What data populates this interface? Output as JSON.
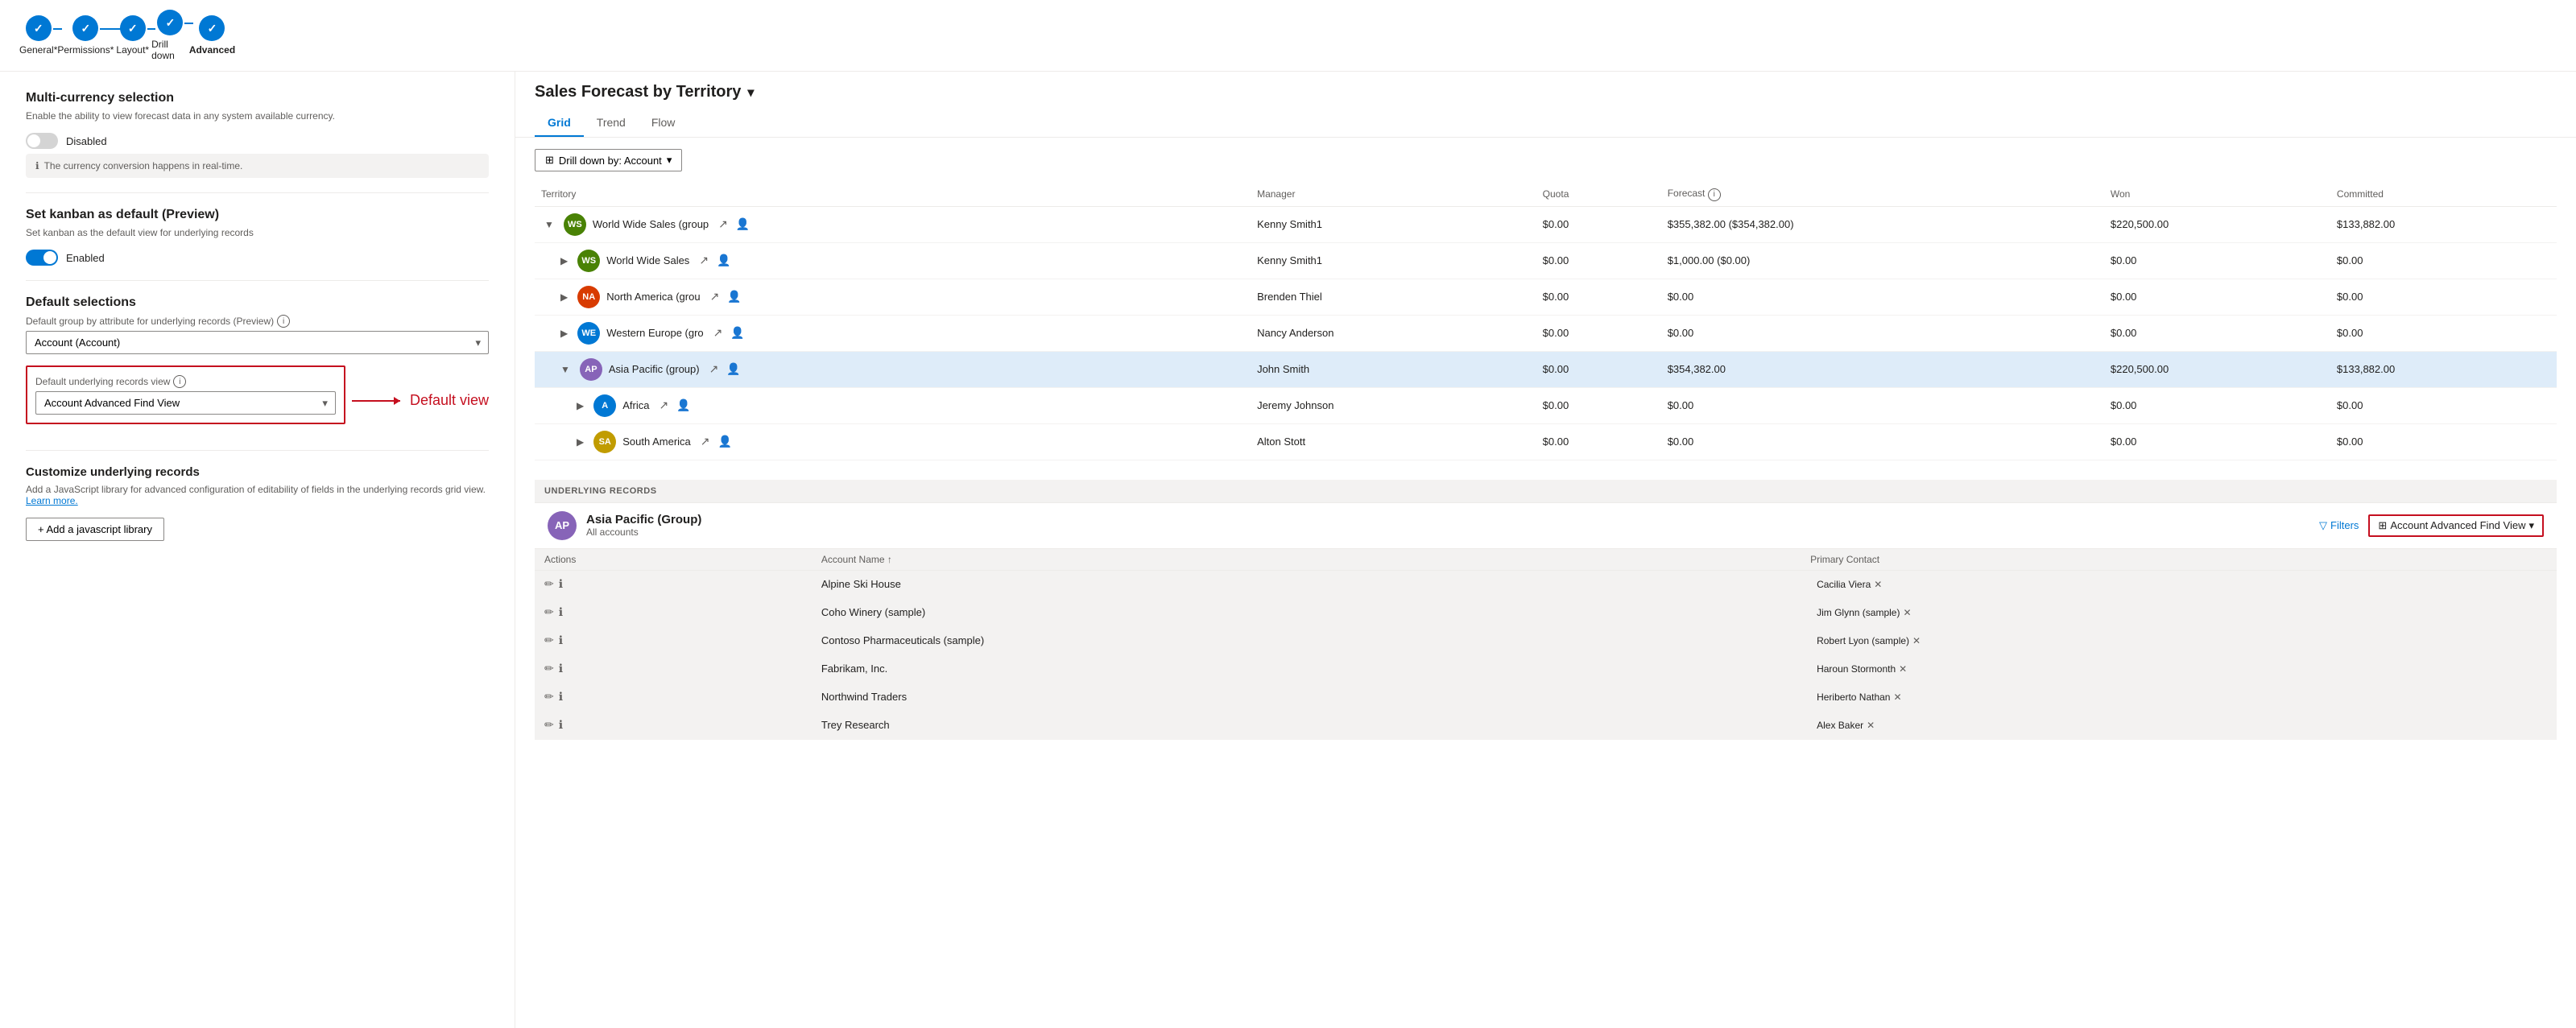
{
  "wizard": {
    "steps": [
      {
        "id": "general",
        "label": "General*",
        "active": false
      },
      {
        "id": "permissions",
        "label": "Permissions*",
        "active": false
      },
      {
        "id": "layout",
        "label": "Layout*",
        "active": false
      },
      {
        "id": "drilldown",
        "label": "Drill down",
        "active": false
      },
      {
        "id": "advanced",
        "label": "Advanced",
        "active": true
      }
    ]
  },
  "left": {
    "multicurrency": {
      "title": "Multi-currency selection",
      "desc": "Enable the ability to view forecast data in any system available currency.",
      "toggle_state": "Disabled",
      "info": "The currency conversion happens in real-time."
    },
    "kanban": {
      "title": "Set kanban as default (Preview)",
      "desc": "Set kanban as the default view for underlying records",
      "toggle_state": "Enabled"
    },
    "default_selections": {
      "title": "Default selections",
      "group_label": "Default group by attribute for underlying records (Preview)",
      "group_value": "Account (Account)",
      "view_label": "Default underlying records view",
      "view_value": "Account Advanced Find View",
      "annotation": "Default view"
    },
    "customize": {
      "title": "Customize underlying records",
      "desc": "Add a JavaScript library for advanced configuration of editability of fields in the underlying records grid view.",
      "learn_more": "Learn more.",
      "add_btn": "+ Add a javascript library"
    }
  },
  "right": {
    "title": "Sales Forecast by Territory",
    "tabs": [
      "Grid",
      "Trend",
      "Flow"
    ],
    "active_tab": "Grid",
    "drill_btn": "Drill down by: Account",
    "columns": [
      "Territory",
      "Manager",
      "Quota",
      "Forecast",
      "Won",
      "Committed"
    ],
    "rows": [
      {
        "indent": 0,
        "expanded": true,
        "avatar_text": "WS",
        "avatar_color": "#498205",
        "name": "World Wide Sales (group",
        "manager": "Kenny Smith1",
        "quota": "$0.00",
        "forecast": "$355,382.00 ($354,382.00)",
        "won": "$220,500.00",
        "committed": "$133,882.00",
        "highlight": false
      },
      {
        "indent": 1,
        "expanded": false,
        "avatar_text": "WS",
        "avatar_color": "#498205",
        "name": "World Wide Sales",
        "manager": "Kenny Smith1",
        "quota": "$0.00",
        "forecast": "$1,000.00 ($0.00)",
        "won": "$0.00",
        "committed": "$0.00",
        "highlight": false
      },
      {
        "indent": 1,
        "expanded": false,
        "avatar_text": "NA",
        "avatar_color": "#d83b01",
        "name": "North America (grou",
        "manager": "Brenden Thiel",
        "quota": "$0.00",
        "forecast": "$0.00",
        "won": "$0.00",
        "committed": "$0.00",
        "highlight": false
      },
      {
        "indent": 1,
        "expanded": false,
        "avatar_text": "WE",
        "avatar_color": "#0078d4",
        "name": "Western Europe (gro",
        "manager": "Nancy Anderson",
        "quota": "$0.00",
        "forecast": "$0.00",
        "won": "$0.00",
        "committed": "$0.00",
        "highlight": false
      },
      {
        "indent": 1,
        "expanded": true,
        "avatar_text": "AP",
        "avatar_color": "#8764b8",
        "name": "Asia Pacific (group)",
        "manager": "John Smith",
        "quota": "$0.00",
        "forecast": "$354,382.00",
        "won": "$220,500.00",
        "committed": "$133,882.00",
        "highlight": true
      },
      {
        "indent": 2,
        "expanded": false,
        "avatar_text": "A",
        "avatar_color": "#0078d4",
        "name": "Africa",
        "manager": "Jeremy Johnson",
        "quota": "$0.00",
        "forecast": "$0.00",
        "won": "$0.00",
        "committed": "$0.00",
        "highlight": false
      },
      {
        "indent": 2,
        "expanded": false,
        "avatar_text": "SA",
        "avatar_color": "#c19c00",
        "name": "South America",
        "manager": "Alton Stott",
        "quota": "$0.00",
        "forecast": "$0.00",
        "won": "$0.00",
        "committed": "$0.00",
        "highlight": false
      }
    ],
    "underlying": {
      "label": "UNDERLYING RECORDS",
      "group_avatar": "AP",
      "group_title": "Asia Pacific (Group)",
      "group_sub": "All accounts",
      "filter_btn": "Filters",
      "view_label": "Account Advanced Find View",
      "columns": [
        "Actions",
        "Account Name",
        "Primary Contact"
      ],
      "rows": [
        {
          "name": "Alpine Ski House",
          "contact": "Cacilia Viera"
        },
        {
          "name": "Coho Winery (sample)",
          "contact": "Jim Glynn (sample)"
        },
        {
          "name": "Contoso Pharmaceuticals (sample)",
          "contact": "Robert Lyon (sample)"
        },
        {
          "name": "Fabrikam, Inc.",
          "contact": "Haroun Stormonth"
        },
        {
          "name": "Northwind Traders",
          "contact": "Heriberto Nathan"
        },
        {
          "name": "Trey Research",
          "contact": "Alex Baker"
        }
      ]
    }
  }
}
